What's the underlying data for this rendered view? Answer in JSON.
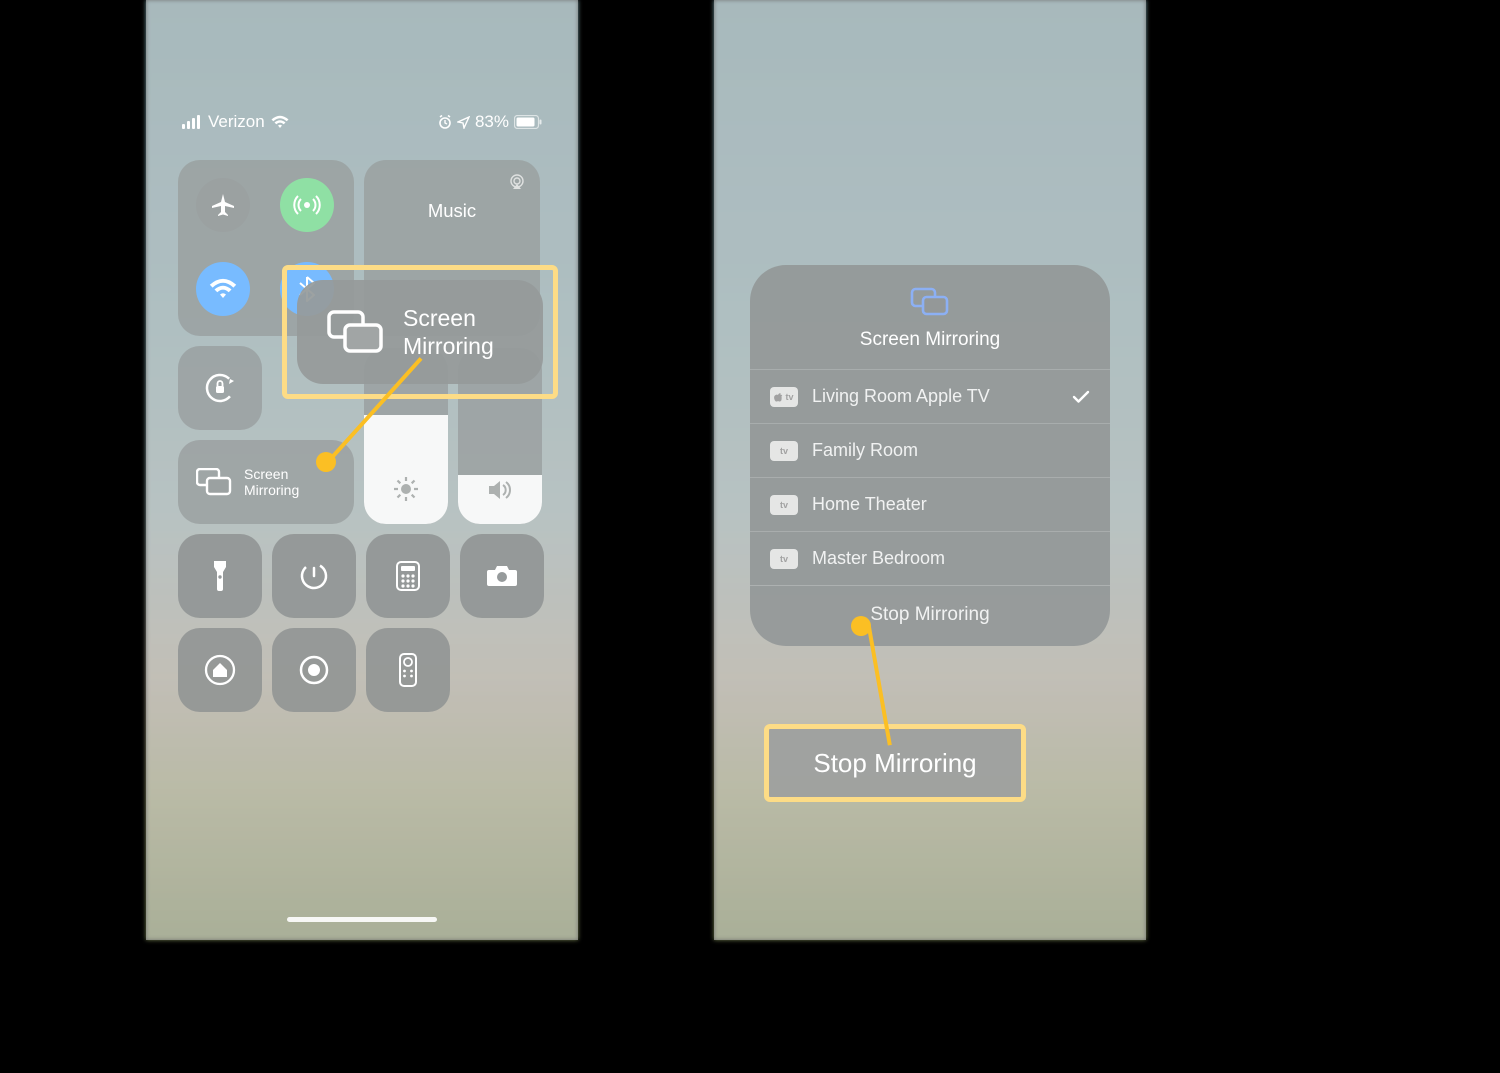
{
  "left": {
    "status": {
      "carrier": "Verizon",
      "battery_text": "83%"
    },
    "music_label": "Music",
    "screen_mirroring_line1": "Screen",
    "screen_mirroring_line2": "Mirroring",
    "callout_line1": "Screen",
    "callout_line2": "Mirroring"
  },
  "right": {
    "panel_title": "Screen Mirroring",
    "devices": [
      {
        "label": "Living Room Apple TV",
        "badge": "tv",
        "selected": true
      },
      {
        "label": "Family Room",
        "badge": "tv",
        "selected": false
      },
      {
        "label": "Home Theater",
        "badge": "tv",
        "selected": false
      },
      {
        "label": "Master Bedroom",
        "badge": "tv",
        "selected": false
      }
    ],
    "stop_label": "Stop Mirroring",
    "callout_label": "Stop Mirroring"
  },
  "colors": {
    "highlight": "#fbbf24",
    "green": "#34c759",
    "blue": "#0a84ff",
    "mirror_icon_blue": "#2f6fec"
  }
}
